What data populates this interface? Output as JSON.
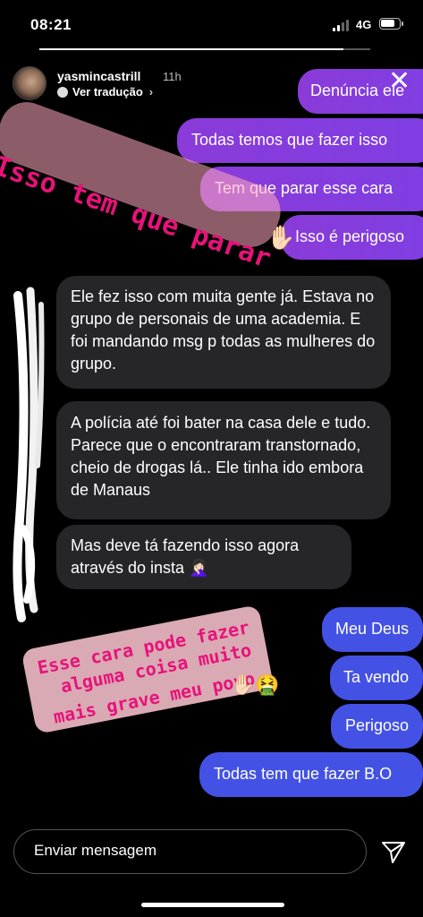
{
  "status_bar": {
    "time": "08:21",
    "network": "4G"
  },
  "story": {
    "progress": 0.92
  },
  "header": {
    "username": "yasmincastrill",
    "time_ago": "11h",
    "translate_label": "Ver tradução",
    "close_icon": "close-icon"
  },
  "messages": {
    "outgoing_purple": [
      "Denúncia ele",
      "Todas temos que fazer isso",
      "Tem que parar esse cara",
      "Isso é perigoso"
    ],
    "incoming": [
      "Ele fez isso com muita gente já. Estava no grupo de personais de uma academia. E foi mandando msg p todas as mulheres do grupo.",
      "A polícia até foi bater na casa dele e tudo. Parece que o encontraram transtornado, cheio de drogas lá.. Ele tinha ido embora de Manaus",
      "Mas deve tá fazendo isso agora através do insta 🤦🏻‍♀️"
    ],
    "outgoing_blue": [
      "Meu Deus",
      "Ta vendo",
      "Perigoso",
      "Todas tem que fazer B.O"
    ]
  },
  "overlays": {
    "caption_top": "Isso tem que parar",
    "caption_bottom": [
      "Esse cara pode fazer",
      "alguma coisa  muito",
      "mais grave meu povo"
    ],
    "emoji_top": "✋🏻",
    "emoji_bottom": "✋🏻🤮"
  },
  "composer": {
    "placeholder": "Enviar mensagem",
    "send_icon": "send-icon"
  },
  "colors": {
    "purple_bubble": "#8a3bd8",
    "blue_bubble": "#4352e4",
    "incoming_bubble": "#262629",
    "pink_text": "#e8127a"
  }
}
